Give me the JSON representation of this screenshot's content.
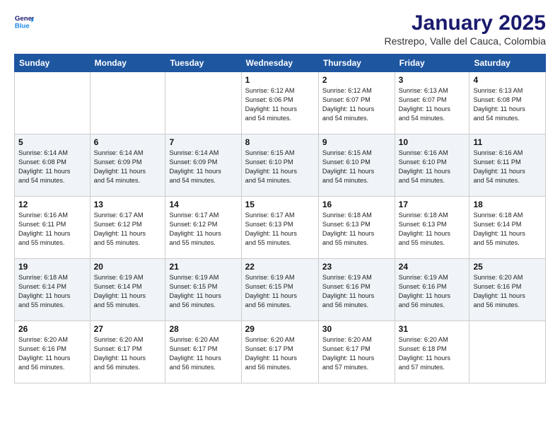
{
  "header": {
    "logo_line1": "General",
    "logo_line2": "Blue",
    "month": "January 2025",
    "location": "Restrepo, Valle del Cauca, Colombia"
  },
  "weekdays": [
    "Sunday",
    "Monday",
    "Tuesday",
    "Wednesday",
    "Thursday",
    "Friday",
    "Saturday"
  ],
  "weeks": [
    [
      {
        "day": "",
        "info": ""
      },
      {
        "day": "",
        "info": ""
      },
      {
        "day": "",
        "info": ""
      },
      {
        "day": "1",
        "info": "Sunrise: 6:12 AM\nSunset: 6:06 PM\nDaylight: 11 hours\nand 54 minutes."
      },
      {
        "day": "2",
        "info": "Sunrise: 6:12 AM\nSunset: 6:07 PM\nDaylight: 11 hours\nand 54 minutes."
      },
      {
        "day": "3",
        "info": "Sunrise: 6:13 AM\nSunset: 6:07 PM\nDaylight: 11 hours\nand 54 minutes."
      },
      {
        "day": "4",
        "info": "Sunrise: 6:13 AM\nSunset: 6:08 PM\nDaylight: 11 hours\nand 54 minutes."
      }
    ],
    [
      {
        "day": "5",
        "info": "Sunrise: 6:14 AM\nSunset: 6:08 PM\nDaylight: 11 hours\nand 54 minutes."
      },
      {
        "day": "6",
        "info": "Sunrise: 6:14 AM\nSunset: 6:09 PM\nDaylight: 11 hours\nand 54 minutes."
      },
      {
        "day": "7",
        "info": "Sunrise: 6:14 AM\nSunset: 6:09 PM\nDaylight: 11 hours\nand 54 minutes."
      },
      {
        "day": "8",
        "info": "Sunrise: 6:15 AM\nSunset: 6:10 PM\nDaylight: 11 hours\nand 54 minutes."
      },
      {
        "day": "9",
        "info": "Sunrise: 6:15 AM\nSunset: 6:10 PM\nDaylight: 11 hours\nand 54 minutes."
      },
      {
        "day": "10",
        "info": "Sunrise: 6:16 AM\nSunset: 6:10 PM\nDaylight: 11 hours\nand 54 minutes."
      },
      {
        "day": "11",
        "info": "Sunrise: 6:16 AM\nSunset: 6:11 PM\nDaylight: 11 hours\nand 54 minutes."
      }
    ],
    [
      {
        "day": "12",
        "info": "Sunrise: 6:16 AM\nSunset: 6:11 PM\nDaylight: 11 hours\nand 55 minutes."
      },
      {
        "day": "13",
        "info": "Sunrise: 6:17 AM\nSunset: 6:12 PM\nDaylight: 11 hours\nand 55 minutes."
      },
      {
        "day": "14",
        "info": "Sunrise: 6:17 AM\nSunset: 6:12 PM\nDaylight: 11 hours\nand 55 minutes."
      },
      {
        "day": "15",
        "info": "Sunrise: 6:17 AM\nSunset: 6:13 PM\nDaylight: 11 hours\nand 55 minutes."
      },
      {
        "day": "16",
        "info": "Sunrise: 6:18 AM\nSunset: 6:13 PM\nDaylight: 11 hours\nand 55 minutes."
      },
      {
        "day": "17",
        "info": "Sunrise: 6:18 AM\nSunset: 6:13 PM\nDaylight: 11 hours\nand 55 minutes."
      },
      {
        "day": "18",
        "info": "Sunrise: 6:18 AM\nSunset: 6:14 PM\nDaylight: 11 hours\nand 55 minutes."
      }
    ],
    [
      {
        "day": "19",
        "info": "Sunrise: 6:18 AM\nSunset: 6:14 PM\nDaylight: 11 hours\nand 55 minutes."
      },
      {
        "day": "20",
        "info": "Sunrise: 6:19 AM\nSunset: 6:14 PM\nDaylight: 11 hours\nand 55 minutes."
      },
      {
        "day": "21",
        "info": "Sunrise: 6:19 AM\nSunset: 6:15 PM\nDaylight: 11 hours\nand 56 minutes."
      },
      {
        "day": "22",
        "info": "Sunrise: 6:19 AM\nSunset: 6:15 PM\nDaylight: 11 hours\nand 56 minutes."
      },
      {
        "day": "23",
        "info": "Sunrise: 6:19 AM\nSunset: 6:16 PM\nDaylight: 11 hours\nand 56 minutes."
      },
      {
        "day": "24",
        "info": "Sunrise: 6:19 AM\nSunset: 6:16 PM\nDaylight: 11 hours\nand 56 minutes."
      },
      {
        "day": "25",
        "info": "Sunrise: 6:20 AM\nSunset: 6:16 PM\nDaylight: 11 hours\nand 56 minutes."
      }
    ],
    [
      {
        "day": "26",
        "info": "Sunrise: 6:20 AM\nSunset: 6:16 PM\nDaylight: 11 hours\nand 56 minutes."
      },
      {
        "day": "27",
        "info": "Sunrise: 6:20 AM\nSunset: 6:17 PM\nDaylight: 11 hours\nand 56 minutes."
      },
      {
        "day": "28",
        "info": "Sunrise: 6:20 AM\nSunset: 6:17 PM\nDaylight: 11 hours\nand 56 minutes."
      },
      {
        "day": "29",
        "info": "Sunrise: 6:20 AM\nSunset: 6:17 PM\nDaylight: 11 hours\nand 56 minutes."
      },
      {
        "day": "30",
        "info": "Sunrise: 6:20 AM\nSunset: 6:17 PM\nDaylight: 11 hours\nand 57 minutes."
      },
      {
        "day": "31",
        "info": "Sunrise: 6:20 AM\nSunset: 6:18 PM\nDaylight: 11 hours\nand 57 minutes."
      },
      {
        "day": "",
        "info": ""
      }
    ]
  ]
}
